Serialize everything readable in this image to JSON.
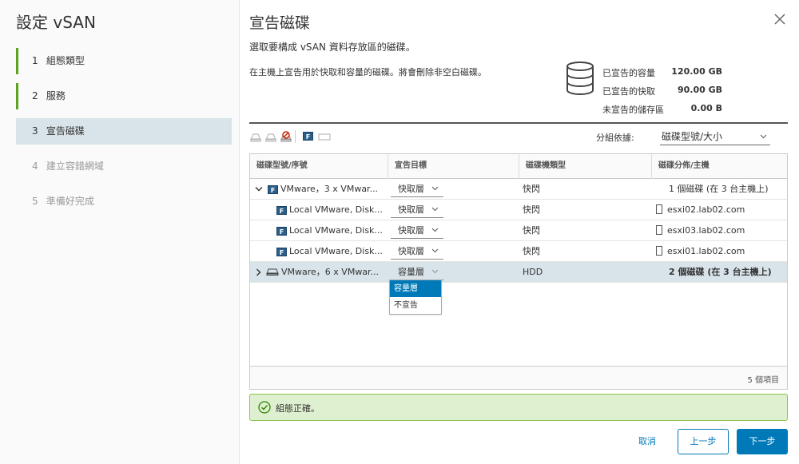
{
  "wizard": {
    "title": "設定 vSAN",
    "steps": [
      {
        "num": "1",
        "label": "組態類型"
      },
      {
        "num": "2",
        "label": "服務"
      },
      {
        "num": "3",
        "label": "宣告磁碟"
      },
      {
        "num": "4",
        "label": "建立容錯網域"
      },
      {
        "num": "5",
        "label": "準備好完成"
      }
    ]
  },
  "page": {
    "title": "宣告磁碟",
    "subtitle": "選取要構成 vSAN 資料存放區的磁碟。",
    "description": "在主機上宣告用於快取和容量的磁碟。將會刪除非空白磁碟。"
  },
  "summary": {
    "capacity_label": "已宣告的容量",
    "capacity_value": "120.00 GB",
    "cache_label": "已宣告的快取",
    "cache_value": "90.00 GB",
    "unclaimed_label": "未宣告的儲存區",
    "unclaimed_value": "0.00 B"
  },
  "toolbar": {
    "groupby_label": "分組依據:",
    "groupby_value": "磁碟型號/大小",
    "icons": [
      "claim-cache-icon",
      "claim-capacity-icon",
      "unclaim-icon",
      "flash-icon",
      "hdd-icon"
    ]
  },
  "table": {
    "headers": [
      "磁碟型號/序號",
      "宣告目標",
      "磁碟機類型",
      "磁碟分佈/主機"
    ],
    "rows": [
      {
        "name": "VMware，3 x VMwar...",
        "target": "快取層",
        "type": "快閃",
        "dist": "1 個磁碟 (在 3 台主機上)",
        "group": true,
        "expanded": true,
        "flash": true
      },
      {
        "name": "Local VMware, Disk...",
        "target": "快取層",
        "type": "快閃",
        "dist": "esxi02.lab02.com",
        "group": false,
        "flash": true
      },
      {
        "name": "Local VMware, Disk...",
        "target": "快取層",
        "type": "快閃",
        "dist": "esxi03.lab02.com",
        "group": false,
        "flash": true
      },
      {
        "name": "Local VMware, Disk...",
        "target": "快取層",
        "type": "快閃",
        "dist": "esxi01.lab02.com",
        "group": false,
        "flash": true
      },
      {
        "name": "VMware，6 x VMwar...",
        "target": "容量層",
        "type": "HDD",
        "dist": "2 個磁碟 (在 3 台主機上)",
        "group": true,
        "expanded": false,
        "flash": false
      }
    ],
    "dropdown_options": [
      "容量層",
      "不宣告"
    ],
    "footer_count": "5 個項目",
    "flash_badge": "F"
  },
  "status": {
    "text": "組態正確。"
  },
  "buttons": {
    "cancel": "取消",
    "prev": "上一步",
    "next": "下一步"
  },
  "colors": {
    "accent": "#0079b8",
    "step_done": "#5aa220",
    "selected_row": "#d9e4ea",
    "status_bg": "#dff0d0"
  }
}
